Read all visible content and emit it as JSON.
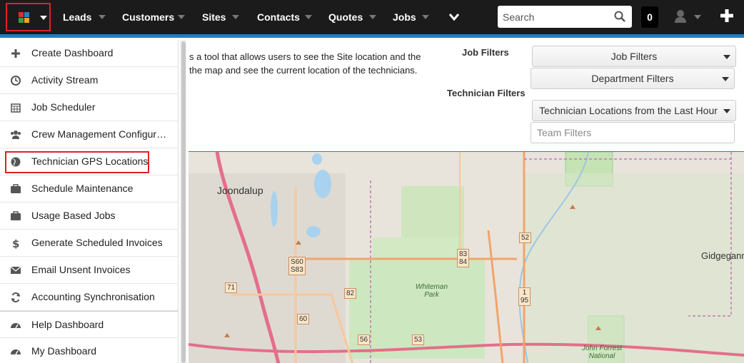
{
  "nav": {
    "items": [
      {
        "label": "Leads"
      },
      {
        "label": "Customers"
      },
      {
        "label": "Sites"
      },
      {
        "label": "Contacts"
      },
      {
        "label": "Quotes"
      },
      {
        "label": "Jobs"
      }
    ],
    "search_placeholder": "Search",
    "notification_count": "0"
  },
  "menu": {
    "items": [
      {
        "label": "Create Dashboard",
        "icon": "plus-icon"
      },
      {
        "label": "Activity Stream",
        "icon": "clock-icon"
      },
      {
        "label": "Job Scheduler",
        "icon": "calendar-icon"
      },
      {
        "label": "Crew Management Configurati…",
        "icon": "users-icon"
      },
      {
        "label": "Technician GPS Locations",
        "icon": "globe-icon"
      },
      {
        "label": "Schedule Maintenance",
        "icon": "briefcase-icon"
      },
      {
        "label": "Usage Based Jobs",
        "icon": "briefcase-icon"
      },
      {
        "label": "Generate Scheduled Invoices",
        "icon": "dollar-icon"
      },
      {
        "label": "Email Unsent Invoices",
        "icon": "envelope-icon"
      },
      {
        "label": "Accounting Synchronisation",
        "icon": "sync-icon"
      },
      {
        "label": "Help Dashboard",
        "icon": "dashboard-icon"
      },
      {
        "label": "My Dashboard",
        "icon": "dashboard-icon"
      }
    ]
  },
  "content": {
    "description_line1": "s a tool that allows users to see the Site location and the",
    "description_line2": "the map and see the current location of the technicians.",
    "job_filters_label": "Job Filters",
    "technician_filters_label": "Technician Filters",
    "job_filters_select": "Job Filters",
    "department_filters_select": "Department Filters",
    "technician_locations_select": "Technician Locations from the Last Hour",
    "team_filters_placeholder": "Team Filters"
  },
  "map": {
    "labels": {
      "joondalup": "Joondalup",
      "whiteman_park": "Whiteman\nPark",
      "gidgegannup": "Gidgegann",
      "john_forrest": "John Forrest\nNational"
    },
    "shields": [
      "52",
      "83\n84",
      "S60\nS83",
      "71",
      "82",
      "1\n95",
      "60",
      "56",
      "53"
    ]
  }
}
